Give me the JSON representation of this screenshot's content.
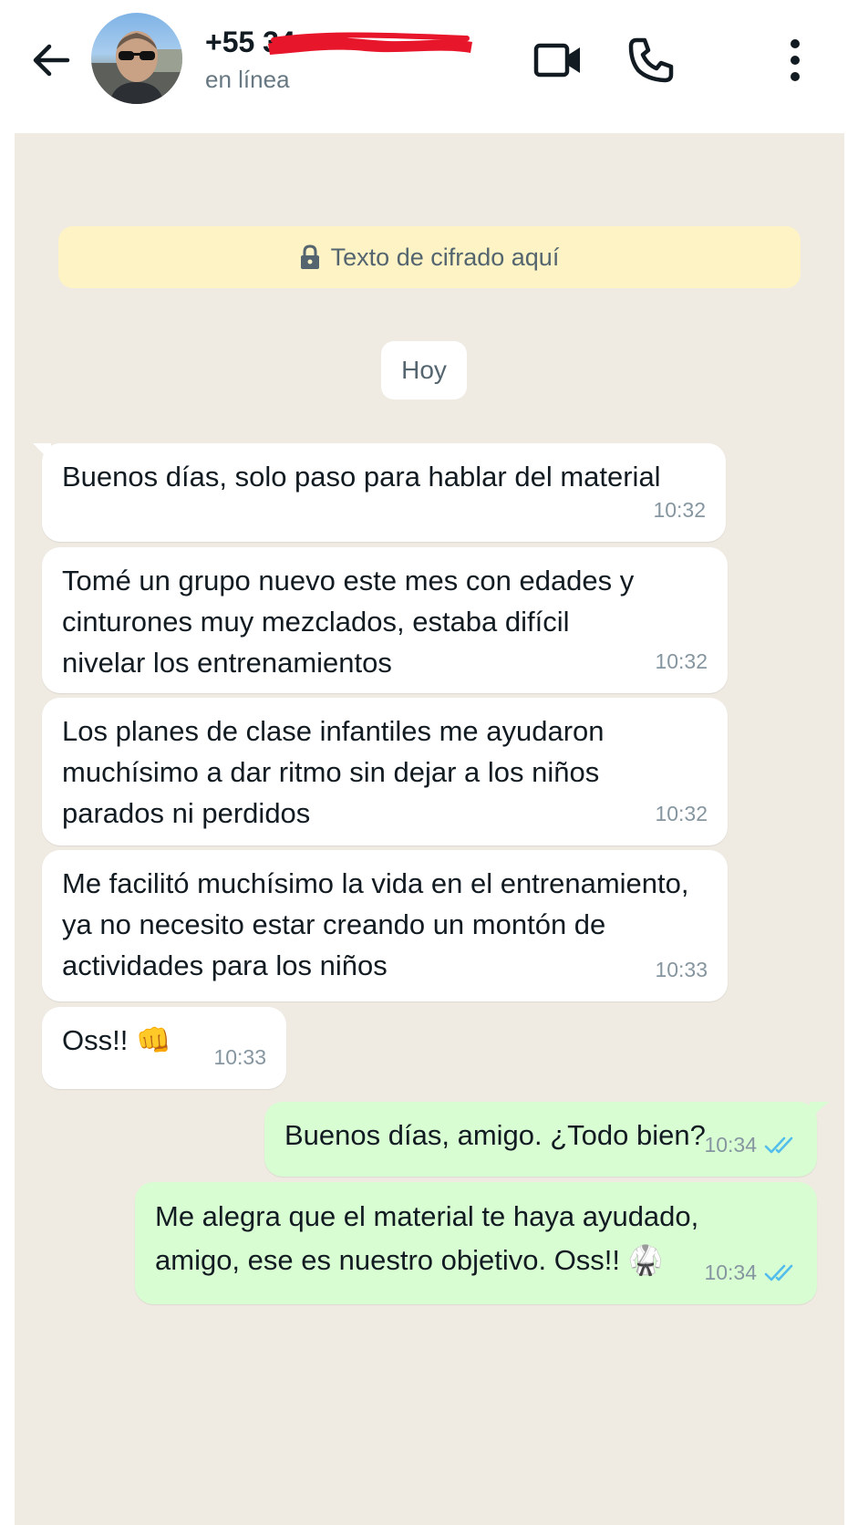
{
  "header": {
    "contact_name": "+55 34",
    "status": "en línea"
  },
  "icons": {
    "back": "arrow-left-icon",
    "video": "video-camera-icon",
    "call": "phone-icon",
    "menu": "more-vertical-icon",
    "lock": "lock-icon",
    "read_receipt": "double-check-icon"
  },
  "colors": {
    "chat_background": "#efeae2",
    "incoming_bubble": "#ffffff",
    "outgoing_bubble": "#d9fdd3",
    "encryption_banner": "#fdf3c5",
    "read_ticks": "#53bdeb",
    "redaction": "#e8162b"
  },
  "chat": {
    "encryption_notice": "Texto de cifrado aquí",
    "date_divider": "Hoy",
    "messages": [
      {
        "direction": "incoming",
        "text": "Buenos días, solo paso para hablar del material",
        "time": "10:32"
      },
      {
        "direction": "incoming",
        "text": "Tomé un grupo nuevo este mes con edades y\ncinturones muy mezclados, estaba difícil\nnivelar los entrenamientos",
        "time": "10:32"
      },
      {
        "direction": "incoming",
        "text": "Los planes de clase infantiles me ayudaron\nmuchísimo a dar ritmo sin dejar a los niños\nparados ni perdidos",
        "time": "10:32"
      },
      {
        "direction": "incoming",
        "text": "Me facilitó muchísimo la vida en el entrenamiento,\nya no necesito estar creando un montón de\nactividades para los niños",
        "time": "10:33"
      },
      {
        "direction": "incoming",
        "text": "Oss!! 👊",
        "time": "10:33"
      },
      {
        "direction": "outgoing",
        "text": "Buenos días, amigo. ¿Todo bien?",
        "time": "10:34",
        "status": "read"
      },
      {
        "direction": "outgoing",
        "text": "Me alegra que el material te haya ayudado,\namigo, ese es nuestro objetivo. Oss!! 🥋",
        "time": "10:34",
        "status": "read"
      }
    ]
  }
}
